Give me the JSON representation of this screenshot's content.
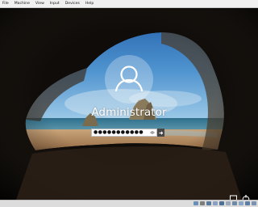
{
  "menubar": {
    "items": [
      "File",
      "Machine",
      "View",
      "Input",
      "Devices",
      "Help"
    ]
  },
  "login": {
    "username": "Administrator",
    "password_mask": "●●●●●●●●●●●"
  },
  "icons": {
    "user": "user-avatar-icon",
    "reveal": "eye-reveal-icon",
    "submit": "arrow-right-icon",
    "network": "network-icon",
    "accessibility": "ease-of-access-icon",
    "power": "power-icon"
  },
  "colors": {
    "menubar": "#f0f0f0",
    "submit": "#474747",
    "statusbar": "#dcdcdc"
  }
}
